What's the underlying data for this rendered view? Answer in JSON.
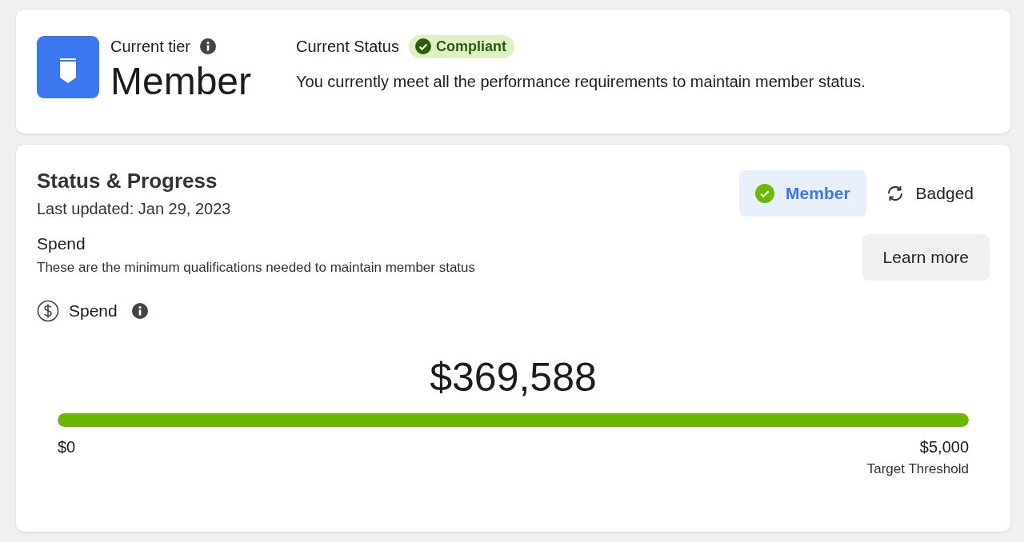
{
  "tier": {
    "label": "Current tier",
    "name": "Member"
  },
  "status": {
    "label": "Current Status",
    "badge": "Compliant",
    "message": "You currently meet all the performance requirements to maintain member status."
  },
  "progress": {
    "title": "Status & Progress",
    "updated": "Last updated: Jan 29, 2023",
    "tabs": [
      {
        "label": "Member",
        "selected": true
      },
      {
        "label": "Badged",
        "selected": false
      }
    ],
    "section_title": "Spend",
    "section_subtitle": "These are the minimum qualifications needed to maintain member status",
    "learn_more": "Learn more",
    "metric": {
      "label": "Spend",
      "value": "$369,588",
      "level": 1,
      "min": "$0",
      "max": "$5,000",
      "max_caption": "Target Threshold"
    }
  }
}
